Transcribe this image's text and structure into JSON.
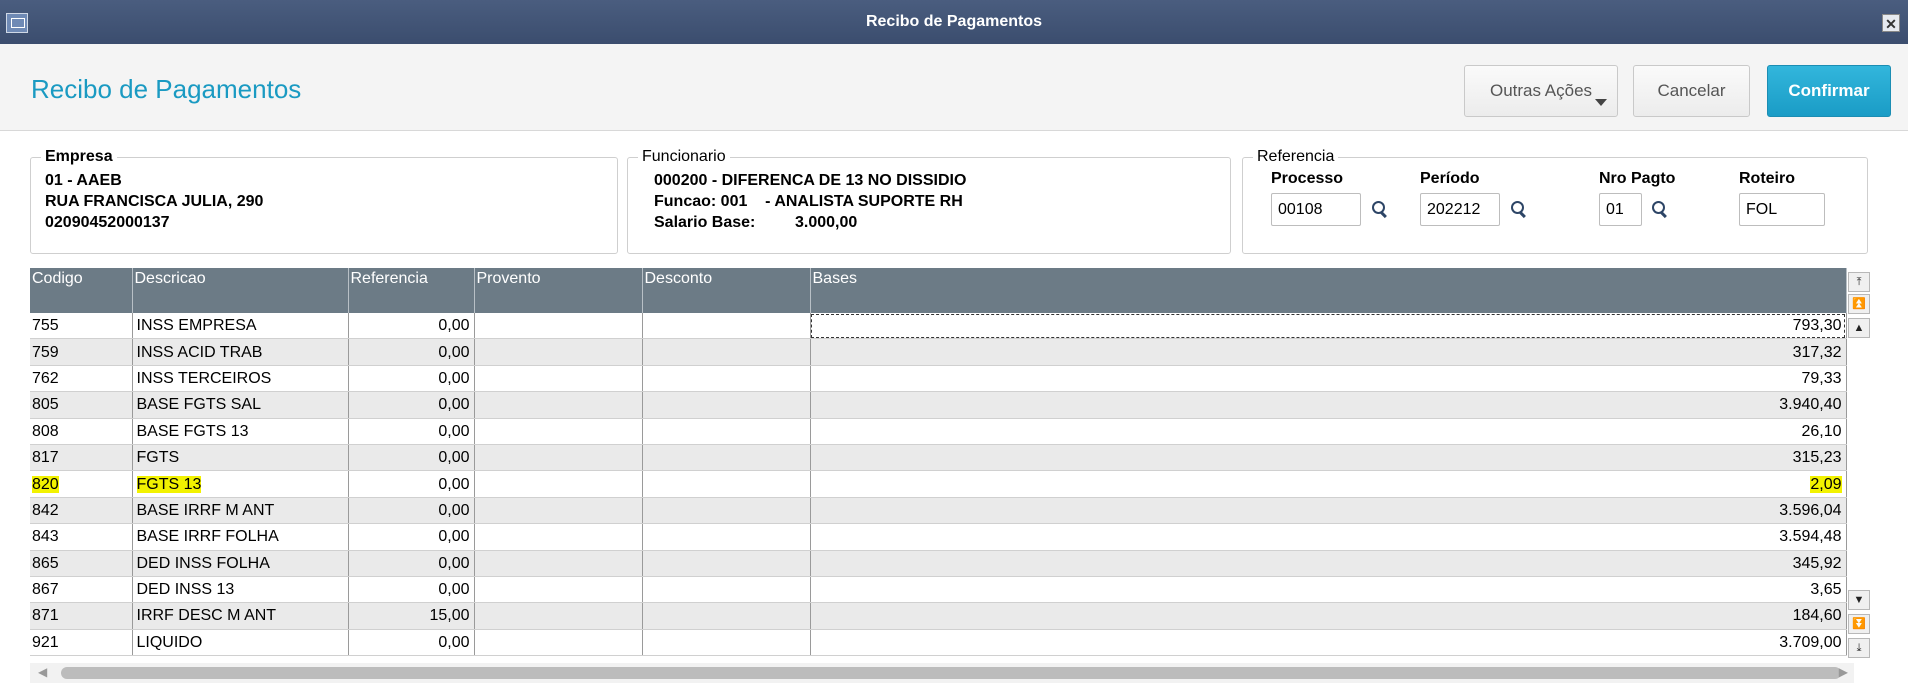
{
  "window": {
    "title": "Recibo de Pagamentos",
    "close_glyph": "✕"
  },
  "header": {
    "title": "Recibo de Pagamentos",
    "buttons": {
      "outras": "Outras Ações",
      "cancelar": "Cancelar",
      "confirmar": "Confirmar"
    }
  },
  "empresa": {
    "legend": "Empresa",
    "line1": "01 - AAEB",
    "line2": "RUA FRANCISCA JULIA, 290",
    "line3": "02090452000137"
  },
  "funcionario": {
    "legend": "Funcionario",
    "line1": "000200 - DIFERENCA DE 13 NO DISSIDIO",
    "line2": "Funcao: 001    - ANALISTA SUPORTE RH",
    "line3_label": "Salario Base:",
    "line3_value": "3.000,00"
  },
  "referencia": {
    "legend": "Referencia",
    "processo_label": "Processo",
    "processo_value": "00108",
    "periodo_label": "Período",
    "periodo_value": "202212",
    "nro_label": "Nro Pagto",
    "nro_value": "01",
    "roteiro_label": "Roteiro",
    "roteiro_value": "FOL"
  },
  "grid": {
    "columns": [
      "Codigo",
      "Descricao",
      "Referencia",
      "Provento",
      "Desconto",
      "Bases"
    ],
    "rows": [
      [
        "755",
        "INSS EMPRESA",
        "0,00",
        "",
        "",
        "793,30"
      ],
      [
        "759",
        "INSS ACID TRAB",
        "0,00",
        "",
        "",
        "317,32"
      ],
      [
        "762",
        "INSS TERCEIROS",
        "0,00",
        "",
        "",
        "79,33"
      ],
      [
        "805",
        "BASE FGTS SAL",
        "0,00",
        "",
        "",
        "3.940,40"
      ],
      [
        "808",
        "BASE FGTS 13",
        "0,00",
        "",
        "",
        "26,10"
      ],
      [
        "817",
        "FGTS",
        "0,00",
        "",
        "",
        "315,23"
      ],
      [
        "820",
        "FGTS 13",
        "0,00",
        "",
        "",
        "2,09"
      ],
      [
        "842",
        "BASE IRRF M ANT",
        "0,00",
        "",
        "",
        "3.596,04"
      ],
      [
        "843",
        "BASE IRRF FOLHA",
        "0,00",
        "",
        "",
        "3.594,48"
      ],
      [
        "865",
        "DED INSS FOLHA",
        "0,00",
        "",
        "",
        "345,92"
      ],
      [
        "867",
        "DED INSS 13",
        "0,00",
        "",
        "",
        "3,65"
      ],
      [
        "871",
        "IRRF DESC M ANT",
        "15,00",
        "",
        "",
        "184,60"
      ],
      [
        "921",
        "LIQUIDO",
        "0,00",
        "",
        "",
        "3.709,00"
      ]
    ],
    "highlighted_row": 6,
    "highlight_color": "#f2f200"
  },
  "colors": {
    "accent": "#1a9ac2",
    "confirm": "#1a9cc6",
    "grid_header": "#6c7b86"
  }
}
